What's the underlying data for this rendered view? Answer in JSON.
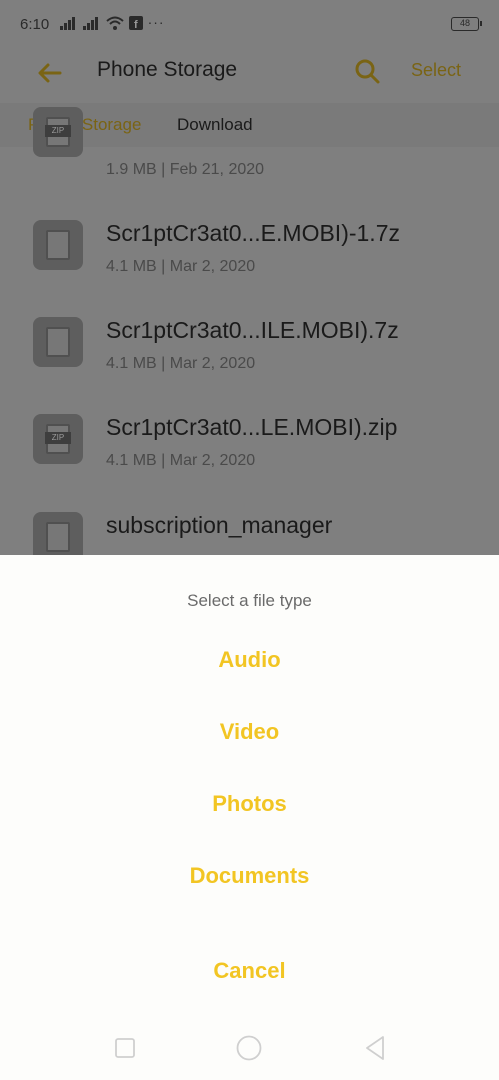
{
  "status_bar": {
    "time": "6:10",
    "icons": [
      "signal-icon",
      "signal-icon",
      "wifi-icon",
      "facebook-icon",
      "more-dots-icon"
    ],
    "more": "···",
    "battery": "48"
  },
  "app_bar": {
    "title": "Phone Storage",
    "select_label": "Select",
    "accent_color": "#f2c523"
  },
  "breadcrumb": [
    "Phone Storage",
    "Download"
  ],
  "files": [
    {
      "name": "",
      "meta": "1.9 MB | Feb 21, 2020",
      "icon": "zip-file-icon"
    },
    {
      "name": "Scr1ptCr3at0...E.MOBI)-1.7z",
      "meta": "4.1 MB | Mar 2, 2020",
      "icon": "document-file-icon"
    },
    {
      "name": "Scr1ptCr3at0...ILE.MOBI).7z",
      "meta": "4.1 MB | Mar 2, 2020",
      "icon": "document-file-icon"
    },
    {
      "name": "Scr1ptCr3at0...LE.MOBI).zip",
      "meta": "4.1 MB | Mar 2, 2020",
      "icon": "zip-file-icon"
    },
    {
      "name": "subscription_manager",
      "meta": "",
      "icon": "document-file-icon"
    }
  ],
  "file_type_sheet": {
    "title": "Select a file type",
    "options": [
      "Audio",
      "Video",
      "Photos",
      "Documents"
    ],
    "cancel_label": "Cancel"
  },
  "nav_bar": {
    "buttons": [
      "recents-square-icon",
      "home-circle-icon",
      "back-triangle-icon"
    ]
  }
}
